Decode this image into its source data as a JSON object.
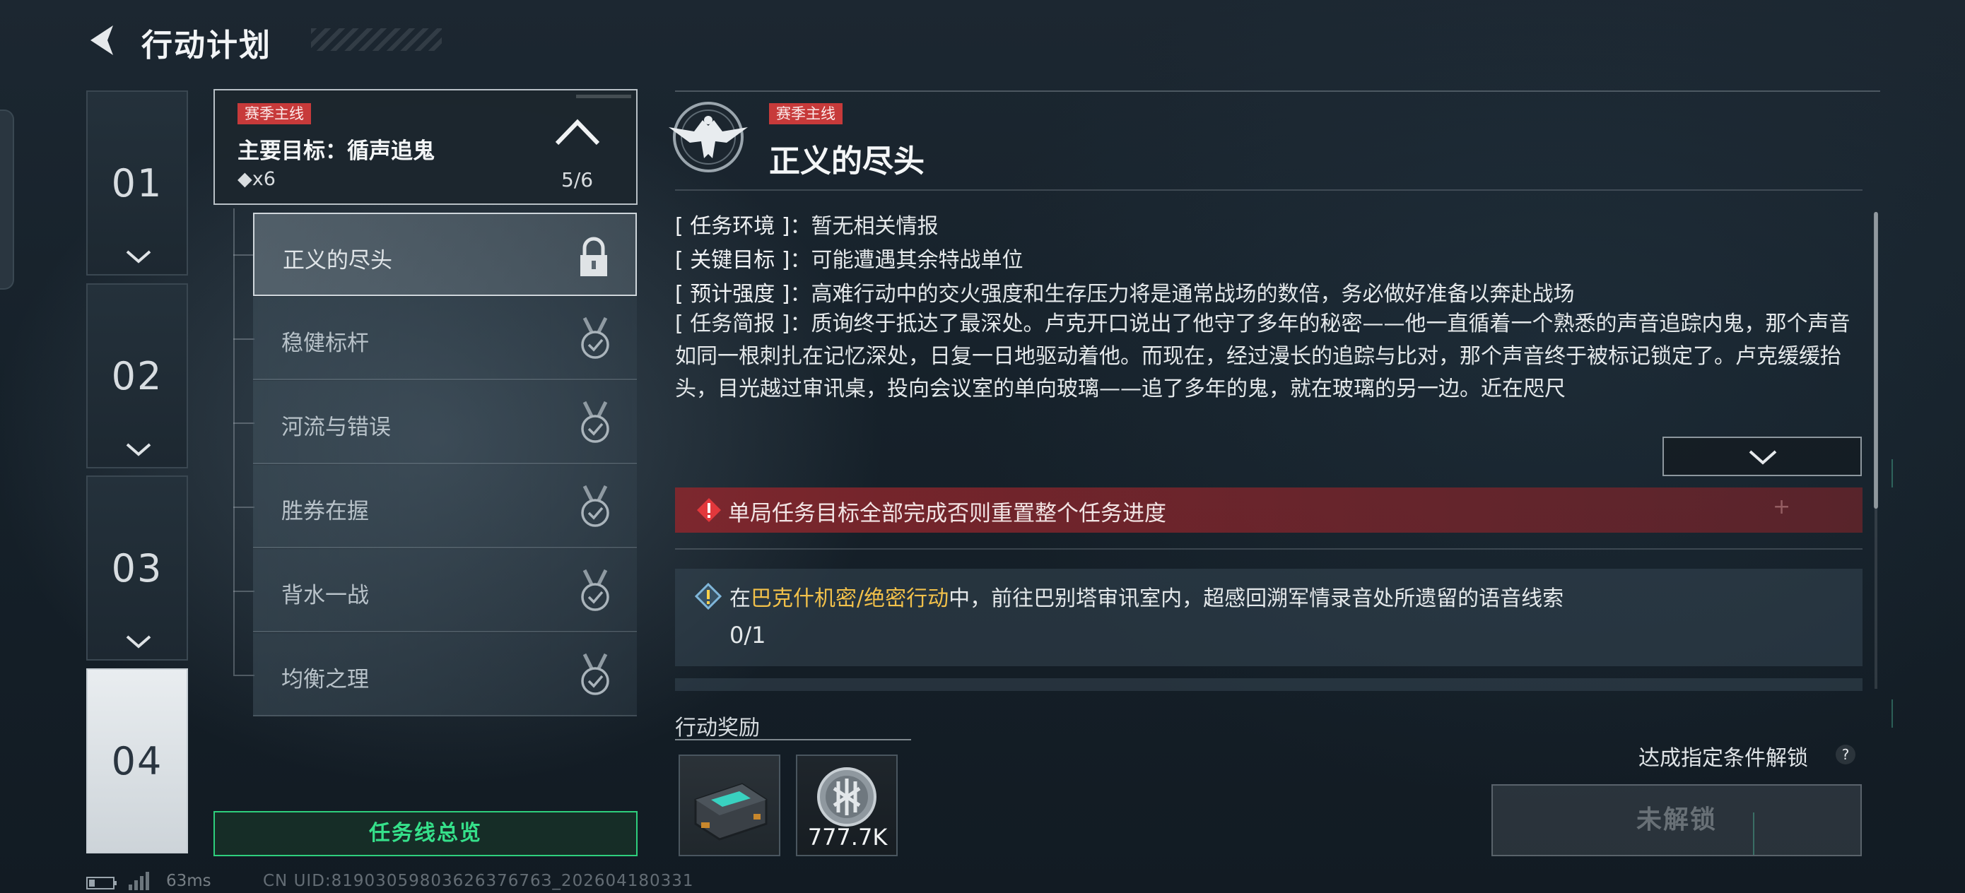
{
  "header": {
    "title": "行动计划"
  },
  "chapters": [
    {
      "label": "01",
      "active": false
    },
    {
      "label": "02",
      "active": false
    },
    {
      "label": "03",
      "active": false
    },
    {
      "label": "04",
      "active": true
    }
  ],
  "mission": {
    "tag": "赛季主线",
    "goal": "主要目标：循声追鬼",
    "count": "◆x6",
    "progress": "5/6"
  },
  "sub_missions": [
    {
      "label": "正义的尽头",
      "status": "locked",
      "icon": "padlock-icon",
      "selected": true
    },
    {
      "label": "稳健标杆",
      "status": "completed",
      "icon": "medal-check-icon"
    },
    {
      "label": "河流与错误",
      "status": "completed",
      "icon": "medal-check-icon"
    },
    {
      "label": "胜券在握",
      "status": "completed",
      "icon": "medal-check-icon"
    },
    {
      "label": "背水一战",
      "status": "completed",
      "icon": "medal-check-icon"
    },
    {
      "label": "均衡之理",
      "status": "completed",
      "icon": "medal-check-icon"
    }
  ],
  "overview_button": "任务线总览",
  "detail": {
    "tag": "赛季主线",
    "title": "正义的尽头",
    "info": [
      {
        "key": "[ 任务环境 ]",
        "value": "：暂无相关情报"
      },
      {
        "key": "[ 关键目标 ]",
        "value": "：可能遭遇其余特战单位"
      },
      {
        "key": "[ 预计强度 ]",
        "value": "：高难行动中的交火强度和生存压力将是通常战场的数倍，务必做好准备以奔赴战场"
      }
    ],
    "briefing_key": "[ 任务简报 ]",
    "briefing_text": "：质询终于抵达了最深处。卢克开口说出了他守了多年的秘密——他一直循着一个熟悉的声音追踪内鬼，那个声音如同一根刺扎在记忆深处，日复一日地驱动着他。而现在，经过漫长的追踪与比对，那个声音终于被标记锁定了。卢克缓缓抬头，目光越过审讯桌，投向会议室的单向玻璃——追了多年的鬼，就在玻璃的另一边。近在咫尺",
    "warning": "单局任务目标全部完成否则重置整个任务进度",
    "warning_plus": "+",
    "objective": {
      "prefix": "在",
      "highlight": "巴克什机密/绝密行动",
      "suffix": "中，前往巴别塔审讯室内，超感回溯军情录音处所遗留的语音线索",
      "progress": "0/1"
    },
    "rewards_label": "行动奖励",
    "rewards": [
      {
        "icon": "device-case-icon",
        "amount": ""
      },
      {
        "icon": "currency-coin-icon",
        "amount": "777.7K"
      }
    ],
    "unlock_hint": "达成指定条件解锁",
    "help_glyph": "?",
    "locked_button": "未解锁"
  },
  "footer": {
    "ping": "63ms",
    "uid": "CN UID:8190305980362637676З_202604180331"
  },
  "colors": {
    "accent_green": "#2ecf7d",
    "tag_red": "#c73a3a",
    "warning_red": "#8c262c",
    "highlight_yellow": "#f2c14a"
  }
}
